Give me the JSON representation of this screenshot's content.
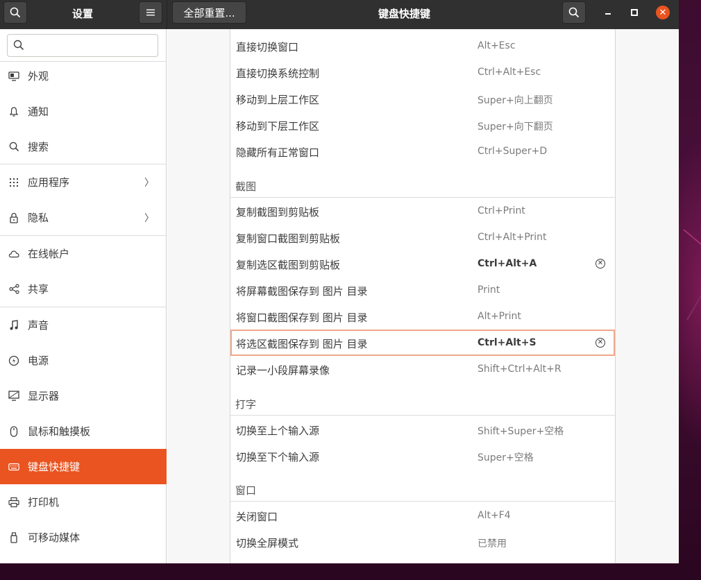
{
  "header": {
    "settings_title": "设置",
    "reset_label": "全部重置...",
    "page_title": "键盘快捷键",
    "search_icon": "search-icon",
    "menu_icon": "hamburger-menu-icon"
  },
  "sidebar": {
    "search_placeholder": "",
    "items": [
      {
        "label": "外观",
        "icon": "appearance-icon"
      },
      {
        "label": "通知",
        "icon": "bell-icon"
      },
      {
        "label": "搜索",
        "icon": "search-icon"
      },
      {
        "label": "应用程序",
        "icon": "apps-grid-icon",
        "chevron": "〉"
      },
      {
        "label": "隐私",
        "icon": "lock-icon",
        "chevron": "〉"
      },
      {
        "label": "在线帐户",
        "icon": "cloud-icon"
      },
      {
        "label": "共享",
        "icon": "share-icon"
      },
      {
        "label": "声音",
        "icon": "music-note-icon"
      },
      {
        "label": "电源",
        "icon": "power-icon"
      },
      {
        "label": "显示器",
        "icon": "display-icon"
      },
      {
        "label": "鼠标和触摸板",
        "icon": "mouse-icon"
      },
      {
        "label": "键盘快捷键",
        "icon": "keyboard-icon",
        "active": true
      },
      {
        "label": "打印机",
        "icon": "printer-icon"
      },
      {
        "label": "可移动媒体",
        "icon": "removable-media-icon"
      }
    ]
  },
  "shortcuts": {
    "nav_rows": [
      {
        "label": "直接切换窗口",
        "accel": "Alt+Esc"
      },
      {
        "label": "直接切换系统控制",
        "accel": "Ctrl+Alt+Esc"
      },
      {
        "label": "移动到上层工作区",
        "accel": "Super+向上翻页"
      },
      {
        "label": "移动到下层工作区",
        "accel": "Super+向下翻页"
      },
      {
        "label": "隐藏所有正常窗口",
        "accel": "Ctrl+Super+D"
      }
    ],
    "screenshot_title": "截图",
    "screenshot_rows": [
      {
        "label": "复制截图到剪贴板",
        "accel": "Ctrl+Print"
      },
      {
        "label": "复制窗口截图到剪贴板",
        "accel": "Ctrl+Alt+Print"
      },
      {
        "label": "复制选区截图到剪贴板",
        "accel": "Ctrl+Alt+A",
        "custom": true
      },
      {
        "label": "将屏幕截图保存到 图片 目录",
        "accel": "Print"
      },
      {
        "label": "将窗口截图保存到 图片 目录",
        "accel": "Alt+Print"
      },
      {
        "label": "将选区截图保存到 图片 目录",
        "accel": "Ctrl+Alt+S",
        "custom": true,
        "focused": true
      },
      {
        "label": "记录一小段屏幕录像",
        "accel": "Shift+Ctrl+Alt+R"
      }
    ],
    "typing_title": "打字",
    "typing_rows": [
      {
        "label": "切换至上个输入源",
        "accel": "Shift+Super+空格"
      },
      {
        "label": "切换至下个输入源",
        "accel": "Super+空格"
      }
    ],
    "window_title": "窗口",
    "window_rows": [
      {
        "label": "关闭窗口",
        "accel": "Alt+F4"
      },
      {
        "label": "切换全屏模式",
        "accel": "已禁用"
      }
    ],
    "clear_glyph": "✕"
  },
  "colors": {
    "accent": "#e95420",
    "header_bg": "#303030",
    "focus_border": "#f0a78a"
  }
}
